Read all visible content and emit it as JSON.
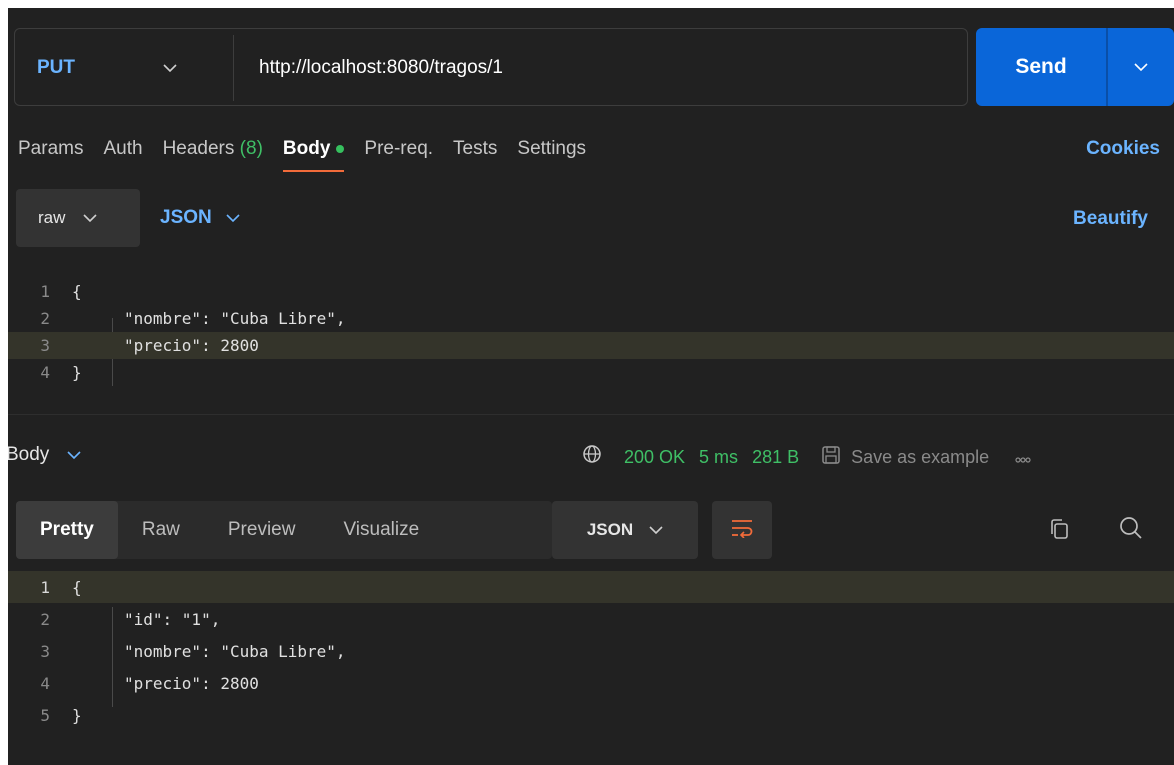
{
  "request": {
    "method": "PUT",
    "url": "http://localhost:8080/tragos/1",
    "send_label": "Send"
  },
  "tabs": [
    {
      "label": "Params"
    },
    {
      "label": "Auth"
    },
    {
      "label": "Headers",
      "count": "(8)"
    },
    {
      "label": "Body",
      "active": true
    },
    {
      "label": "Pre-req."
    },
    {
      "label": "Tests"
    },
    {
      "label": "Settings"
    }
  ],
  "cookies_label": "Cookies",
  "body_mode": {
    "raw": "raw",
    "format": "JSON",
    "beautify": "Beautify"
  },
  "request_body": {
    "line_numbers": [
      "1",
      "2",
      "3",
      "4"
    ],
    "lines": [
      "{",
      "\"nombre\": \"Cuba Libre\",",
      "\"precio\": 2800",
      "}"
    ]
  },
  "response": {
    "section_label": "Body",
    "status": "200 OK",
    "time": "5 ms",
    "size": "281 B",
    "save_label": "Save as example",
    "tabs": [
      "Pretty",
      "Raw",
      "Preview",
      "Visualize"
    ],
    "format": "JSON",
    "line_numbers": [
      "1",
      "2",
      "3",
      "4",
      "5"
    ],
    "lines": [
      "{",
      "\"id\": \"1\",",
      "\"nombre\": \"Cuba Libre\",",
      "\"precio\": 2800",
      "}"
    ]
  },
  "colors": {
    "background": "#212121",
    "accent_blue": "#0a66d9",
    "link_blue": "#6bb4ff",
    "success_green": "#3fbf66",
    "active_underline": "#f26b3a"
  }
}
